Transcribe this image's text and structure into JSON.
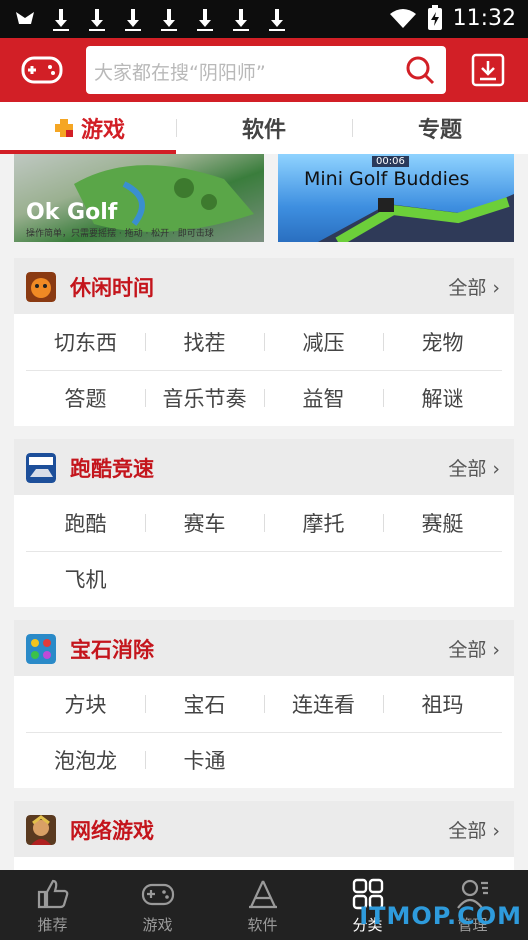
{
  "status": {
    "time": "11:32",
    "left_icons": [
      "notification-icon",
      "download-icon",
      "download-icon",
      "download-icon",
      "download-icon",
      "download-icon",
      "download-icon",
      "download-icon"
    ]
  },
  "header": {
    "search_placeholder": "大家都在搜“阴阳师”",
    "brand_color": "#d21f26"
  },
  "tabs": [
    {
      "label": "游戏",
      "active": true
    },
    {
      "label": "软件",
      "active": false
    },
    {
      "label": "专题",
      "active": false
    }
  ],
  "banners": [
    {
      "title_part1": "Ok",
      "title_part2": "Golf",
      "subtitle": "操作简单，只需要摇摆 · 拖动 · 松开 · 即可击球"
    },
    {
      "title": "Mini Golf Buddies",
      "badge": "00:06"
    }
  ],
  "categories": [
    {
      "title": "休闲时间",
      "all_label": "全部 ›",
      "icon": "casual-game-icon",
      "items": [
        "切东西",
        "找茬",
        "减压",
        "宠物",
        "答题",
        "音乐节奏",
        "益智",
        "解谜"
      ]
    },
    {
      "title": "跑酷竞速",
      "all_label": "全部 ›",
      "icon": "racing-game-icon",
      "items": [
        "跑酷",
        "赛车",
        "摩托",
        "赛艇",
        "飞机"
      ]
    },
    {
      "title": "宝石消除",
      "all_label": "全部 ›",
      "icon": "gem-game-icon",
      "items": [
        "方块",
        "宝石",
        "连连看",
        "祖玛",
        "泡泡龙",
        "卡通"
      ]
    },
    {
      "title": "网络游戏",
      "all_label": "全部 ›",
      "icon": "online-game-icon",
      "items": []
    }
  ],
  "bottom_nav": [
    {
      "label": "推荐",
      "icon": "thumbs-up-icon",
      "active": false
    },
    {
      "label": "游戏",
      "icon": "gamepad-icon",
      "active": false
    },
    {
      "label": "软件",
      "icon": "app-store-icon",
      "active": false
    },
    {
      "label": "分类",
      "icon": "grid-icon",
      "active": true
    },
    {
      "label": "管理",
      "icon": "user-manage-icon",
      "active": false
    }
  ],
  "watermark": "ITMOP.COM"
}
